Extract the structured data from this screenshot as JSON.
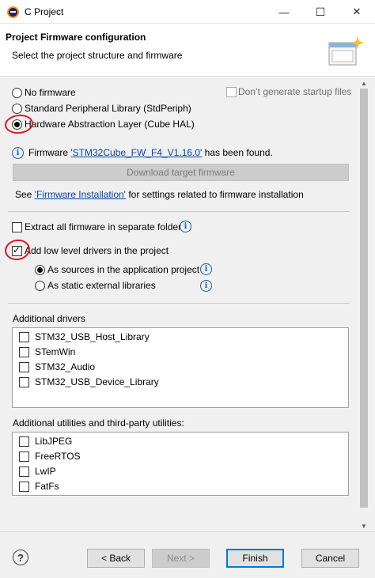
{
  "window": {
    "title": "C Project",
    "minimize": "—",
    "maximize": "☐",
    "close": "✕",
    "icon": "eclipse-icon"
  },
  "header": {
    "title": "Project Firmware configuration",
    "subtitle": "Select the project structure and firmware",
    "image": "wizard-banner-icon"
  },
  "firmware_options": {
    "no_firmware": "No firmware",
    "std_periph": "Standard Peripheral Library (StdPeriph)",
    "cube_hal": "Hardware Abstraction Layer (Cube HAL)",
    "selected": "cube_hal",
    "dont_generate_startup": "Don’t generate startup files"
  },
  "firmware_status": {
    "prefix": "Firmware ",
    "name": "'STM32Cube_FW_F4_V1.16.0'",
    "suffix": " has been found."
  },
  "download_button": "Download target firmware",
  "see_line": {
    "prefix": "See ",
    "link": "'Firmware Installation'",
    "suffix": " for settings related to firmware installation"
  },
  "extract_all": {
    "label": "Extract all firmware in separate folder",
    "checked": false
  },
  "add_ll_drivers": {
    "label": "Add low level drivers in the project",
    "checked": true
  },
  "driver_mode": {
    "sources": "As sources in the application project",
    "static_libs": "As static external libraries",
    "selected": "sources"
  },
  "additional_drivers": {
    "label": "Additional drivers",
    "items": [
      "STM32_USB_Host_Library",
      "STemWin",
      "STM32_Audio",
      "STM32_USB_Device_Library"
    ]
  },
  "additional_utilities": {
    "label": "Additional utilities and third-party utilities:",
    "items": [
      "LibJPEG",
      "FreeRTOS",
      "LwIP",
      "FatFs"
    ]
  },
  "footer": {
    "help": "?",
    "back": "< Back",
    "next": "Next >",
    "finish": "Finish",
    "cancel": "Cancel"
  },
  "colors": {
    "link": "#0645ad",
    "annotation": "#e0141e",
    "info": "#1f5fa8"
  }
}
